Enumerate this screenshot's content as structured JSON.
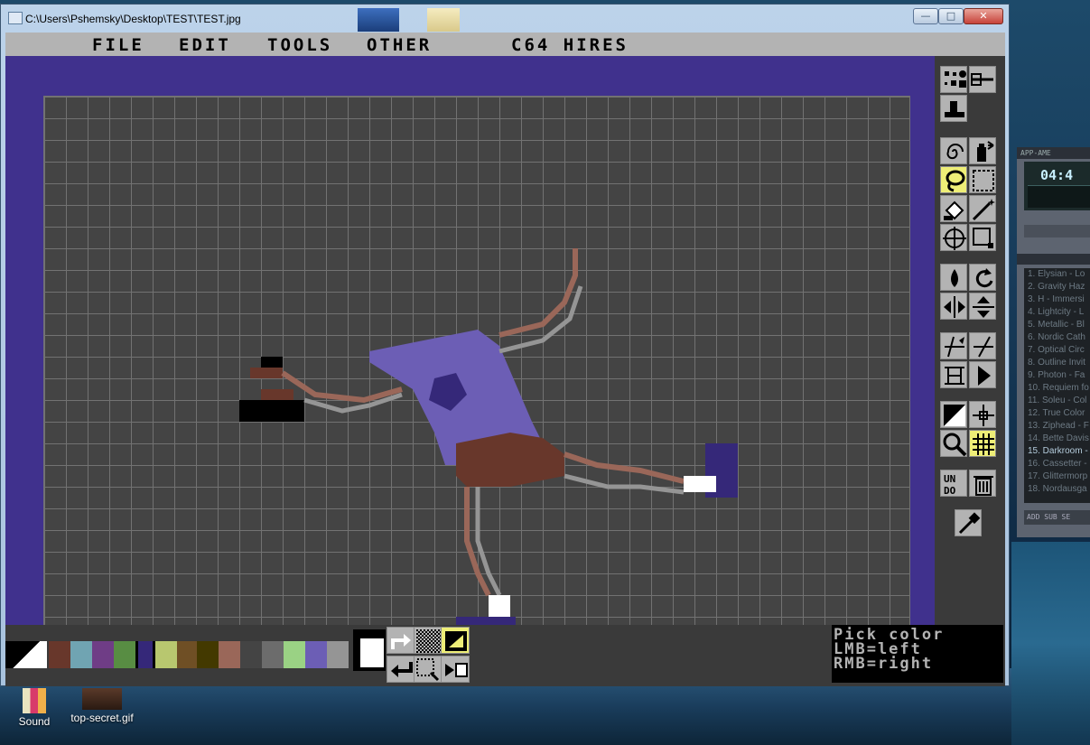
{
  "window": {
    "title": "C:\\Users\\Pshemsky\\Desktop\\TEST\\TEST.jpg",
    "minimize_label": "—",
    "maximize_label": "□",
    "close_label": "✕"
  },
  "menu": {
    "items": [
      "FILE",
      "EDIT",
      "TOOLS",
      "OTHER"
    ],
    "mode": "C64 HIRES"
  },
  "colors": {
    "border": "#40318d",
    "canvas_bg": "#444444",
    "grid": "#727272",
    "selected_tool": "#eeee77",
    "tool_bg": "#b3b3b3"
  },
  "tools": [
    {
      "name": "brush-size-tool",
      "icon": "brush-size-icon",
      "selected": false
    },
    {
      "name": "line-width-tool",
      "icon": "line-width-icon",
      "selected": false
    },
    {
      "name": "stamp-tool",
      "icon": "stamp-icon",
      "selected": false
    },
    {
      "name": "spiral-tool",
      "icon": "spiral-icon",
      "selected": false
    },
    {
      "name": "spray-tool",
      "icon": "spray-can-icon",
      "selected": false
    },
    {
      "name": "lasso-tool",
      "icon": "lasso-icon",
      "selected": true
    },
    {
      "name": "rect-select-tool",
      "icon": "rect-select-icon",
      "selected": false
    },
    {
      "name": "fill-tool",
      "icon": "paint-bucket-icon",
      "selected": false
    },
    {
      "name": "magic-wand-tool",
      "icon": "magic-wand-icon",
      "selected": false
    },
    {
      "name": "crosshair-tool",
      "icon": "crosshair-icon",
      "selected": false
    },
    {
      "name": "crop-tool",
      "icon": "crop-icon",
      "selected": false
    },
    {
      "name": "drop-tool",
      "icon": "ink-drop-icon",
      "selected": false
    },
    {
      "name": "rotate-tool",
      "icon": "rotate-icon",
      "selected": false
    },
    {
      "name": "flip-horizontal-tool",
      "icon": "flip-horizontal-icon",
      "selected": false
    },
    {
      "name": "flip-vertical-tool",
      "icon": "flip-vertical-icon",
      "selected": false
    },
    {
      "name": "skew-tool",
      "icon": "skew-icon",
      "selected": false
    },
    {
      "name": "skew-vertical-tool",
      "icon": "skew-vertical-icon",
      "selected": false
    },
    {
      "name": "align-tool",
      "icon": "align-icon",
      "selected": false
    },
    {
      "name": "play-tool",
      "icon": "play-icon",
      "selected": false
    },
    {
      "name": "color-split-tool",
      "icon": "color-split-icon",
      "selected": false
    },
    {
      "name": "center-tool",
      "icon": "center-icon",
      "selected": false
    },
    {
      "name": "zoom-tool",
      "icon": "magnifier-icon",
      "selected": false
    },
    {
      "name": "grid-tool",
      "icon": "grid-icon",
      "selected": true
    },
    {
      "name": "undo-tool",
      "icon": "undo-icon",
      "selected": false
    },
    {
      "name": "trash-tool",
      "icon": "trash-icon",
      "selected": false
    },
    {
      "name": "eyedropper-tool",
      "icon": "eyedropper-icon",
      "selected": false
    }
  ],
  "palette": [
    "#000000",
    "#ffffff",
    "#68372b",
    "#70a4b2",
    "#6f3d86",
    "#588d43",
    "#352879",
    "#b8c76f",
    "#6f4f25",
    "#433900",
    "#9a6759",
    "#444444",
    "#6c6c6c",
    "#9ad284",
    "#6c5eb5",
    "#959595"
  ],
  "palette_selected": 6,
  "bottom_tools": [
    {
      "name": "redo-tool",
      "icon": "redo-arrow-icon",
      "selected": false
    },
    {
      "name": "dither-tool",
      "icon": "dither-icon",
      "selected": false
    },
    {
      "name": "swap-colors-tool",
      "icon": "swap-colors-icon",
      "selected": true
    },
    {
      "name": "undo-arrow-tool",
      "icon": "undo-arrow-icon",
      "selected": false
    },
    {
      "name": "pattern-fill-tool",
      "icon": "pattern-fill-icon",
      "selected": false
    },
    {
      "name": "preview-tool",
      "icon": "preview-icon",
      "selected": false
    }
  ],
  "status": {
    "line1": "Pick color",
    "line2": "LMB=left",
    "line3": "RMB=right"
  },
  "player": {
    "title": "APP-AME",
    "time": "04:4",
    "playlist": [
      "1. Elysian - Lo",
      "2. Gravity Haz",
      "3. H - Immersi",
      "4. Lightcity - L",
      "5. Metallic - Bl",
      "6. Nordic Cath",
      "7. Optical Circ",
      "8. Outline Invit",
      "9. Photon - Fa",
      "10. Requiem fo",
      "11. Soleu - Col",
      "12. True Color",
      "13. Ziphead - F",
      "14. Bette Davis",
      "15. Darkroom -",
      "16. Cassetter -",
      "17. Glittermorp",
      "18. Nordausga"
    ],
    "current_index": 14,
    "bottom_buttons": "ADD SUB SE"
  },
  "desktop_icons": [
    {
      "label": "Sound"
    },
    {
      "label": "top-secret.gif"
    }
  ]
}
